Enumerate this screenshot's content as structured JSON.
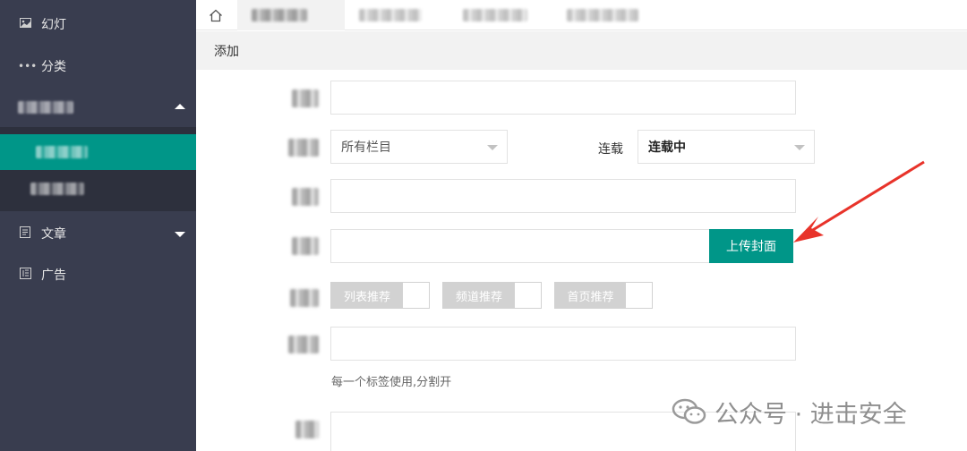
{
  "sidebar": {
    "items": [
      {
        "label": "幻灯",
        "icon": "image-icon"
      },
      {
        "label": "分类",
        "icon": "dots-icon"
      },
      {
        "label": "",
        "icon": "blurred-icon",
        "expanded": true
      },
      {
        "label": "文章",
        "icon": "document-icon",
        "expanded": false
      },
      {
        "label": "广告",
        "icon": "ad-icon"
      }
    ]
  },
  "tabs": {
    "home_icon": "home-icon"
  },
  "breadcrumb": {
    "title": "添加"
  },
  "form": {
    "category_select": {
      "value": "所有栏目"
    },
    "serial_label": "连载",
    "serial_select": {
      "value": "连载中"
    },
    "upload_button": "上传封面",
    "switches": [
      {
        "label": "列表推荐",
        "on": false
      },
      {
        "label": "频道推荐",
        "on": false
      },
      {
        "label": "首页推荐",
        "on": false
      }
    ],
    "tags_hint": "每一个标签使用,分割开"
  },
  "watermark": {
    "text": "公众号 · 进击安全"
  },
  "colors": {
    "sidebar_bg": "#393d4f",
    "accent": "#009688",
    "arrow": "#e8332a"
  }
}
